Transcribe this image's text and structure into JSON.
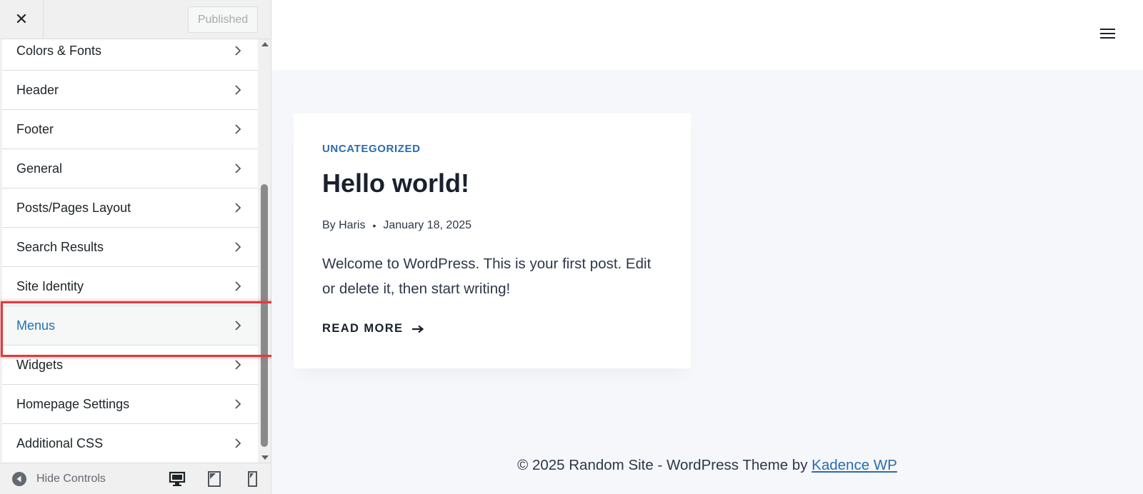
{
  "topbar": {
    "close_icon": "close-icon",
    "publish_label": "Published"
  },
  "panels": [
    {
      "label": "Colors & Fonts"
    },
    {
      "label": "Header"
    },
    {
      "label": "Footer"
    },
    {
      "label": "General"
    },
    {
      "label": "Posts/Pages Layout"
    },
    {
      "label": "Search Results"
    },
    {
      "label": "Site Identity"
    },
    {
      "label": "Menus",
      "active": true
    },
    {
      "label": "Widgets"
    },
    {
      "label": "Homepage Settings"
    },
    {
      "label": "Additional CSS"
    }
  ],
  "footer_bar": {
    "hide_controls_label": "Hide Controls",
    "devices": [
      "desktop-icon",
      "tablet-icon",
      "mobile-icon"
    ]
  },
  "preview": {
    "post": {
      "category": "UNCATEGORIZED",
      "title": "Hello world!",
      "author": "By Haris",
      "separator": "•",
      "date": "January 18, 2025",
      "excerpt": "Welcome to WordPress. This is your first post. Edit or delete it, then start writing!",
      "read_more": "READ MORE",
      "read_more_icon": "arrow-right-icon"
    },
    "footer": {
      "text": "© 2025 Random Site - WordPress Theme by ",
      "link": "Kadence WP"
    }
  },
  "colors": {
    "accent": "#2271b1",
    "link": "#2b6cb0",
    "highlight_border": "#e03a3e"
  }
}
